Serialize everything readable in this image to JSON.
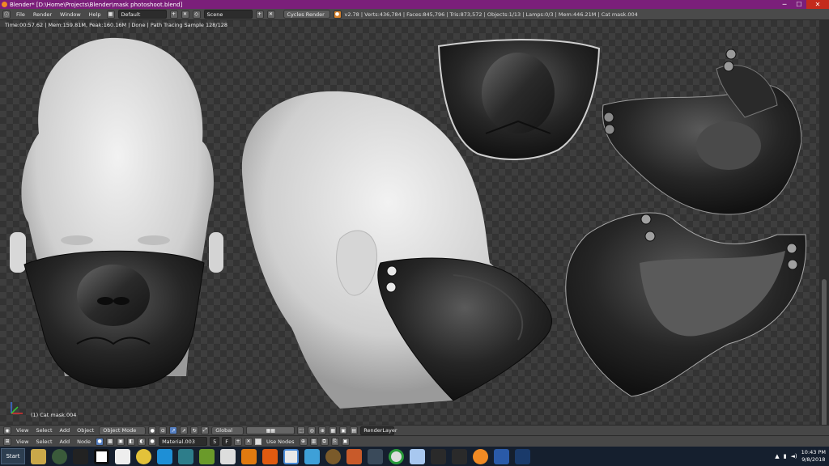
{
  "window": {
    "title": "Blender* [D:\\Home\\Projects\\Blender\\mask photoshoot.blend]"
  },
  "info_header": {
    "menus": [
      "File",
      "Render",
      "Window",
      "Help"
    ],
    "screen_layout": "Default",
    "scene": "Scene",
    "render_engine": "Cycles Render",
    "stats": "v2.78 | Verts:436,784 | Faces:845,796 | Tris:873,572 | Objects:1/13 | Lamps:0/3 | Mem:446.21M | Cat mask.004"
  },
  "viewport": {
    "render_status": "Time:00:57.62 | Mem:159.81M, Peak:160.16M | Done | Path Tracing Sample 128/128",
    "active_object_label": "(1) Cat mask.004"
  },
  "view3d_header": {
    "menus": [
      "View",
      "Select",
      "Add",
      "Object"
    ],
    "mode": "Object Mode",
    "orientation": "Global",
    "render_layer": "RenderLayer"
  },
  "node_header": {
    "menus": [
      "View",
      "Select",
      "Add",
      "Node"
    ],
    "material": "Material.003",
    "material_users": "5",
    "flag_f": "F",
    "use_nodes_label": "Use Nodes"
  },
  "taskbar": {
    "start_label": "Start",
    "time": "10:43 PM",
    "date": "9/8/2018",
    "icons": [
      "folder-icon",
      "media-icon",
      "steam-like-icon",
      "obs-icon",
      "paint-icon",
      "python-icon",
      "app-icon",
      "maya-icon",
      "fusion-icon",
      "tz-icon",
      "sublime-icon",
      "video-icon",
      "camera-icon",
      "substance-icon",
      "gimp-icon",
      "chrome-icon",
      "save-icon",
      "printer-icon",
      "blue-icon",
      "game-icon",
      "blender-icon",
      "photoshop-icon",
      "steam-icon"
    ]
  },
  "colors": {
    "title_bar": "#7b1f7a",
    "taskbar": "#151f2e",
    "viewport_bg": "#3e3e3e"
  }
}
